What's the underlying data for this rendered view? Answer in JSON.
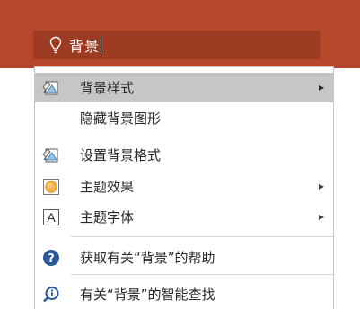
{
  "search": {
    "query": "背景",
    "icon": "lightbulb-icon"
  },
  "menu": {
    "items": [
      {
        "label": "背景样式",
        "icon": "background-styles-icon",
        "submenu": true,
        "highlighted": true
      },
      {
        "label": "隐藏背景图形",
        "icon": "",
        "submenu": false
      },
      {
        "label": "设置背景格式",
        "icon": "format-background-icon",
        "submenu": false
      },
      {
        "label": "主题效果",
        "icon": "theme-effects-icon",
        "submenu": true
      },
      {
        "label": "主题字体",
        "icon": "theme-fonts-icon",
        "icon_text": "A",
        "submenu": true
      },
      {
        "label": "获取有关“背景”的帮助",
        "icon": "help-icon",
        "submenu": false
      },
      {
        "label": "有关“背景”的智能查找",
        "icon": "smart-lookup-icon",
        "submenu": false
      }
    ]
  },
  "colors": {
    "ribbon": "#b7472a",
    "search_box": "#9e3c23",
    "highlight": "#c6c6c6",
    "help_blue": "#2b579a"
  }
}
